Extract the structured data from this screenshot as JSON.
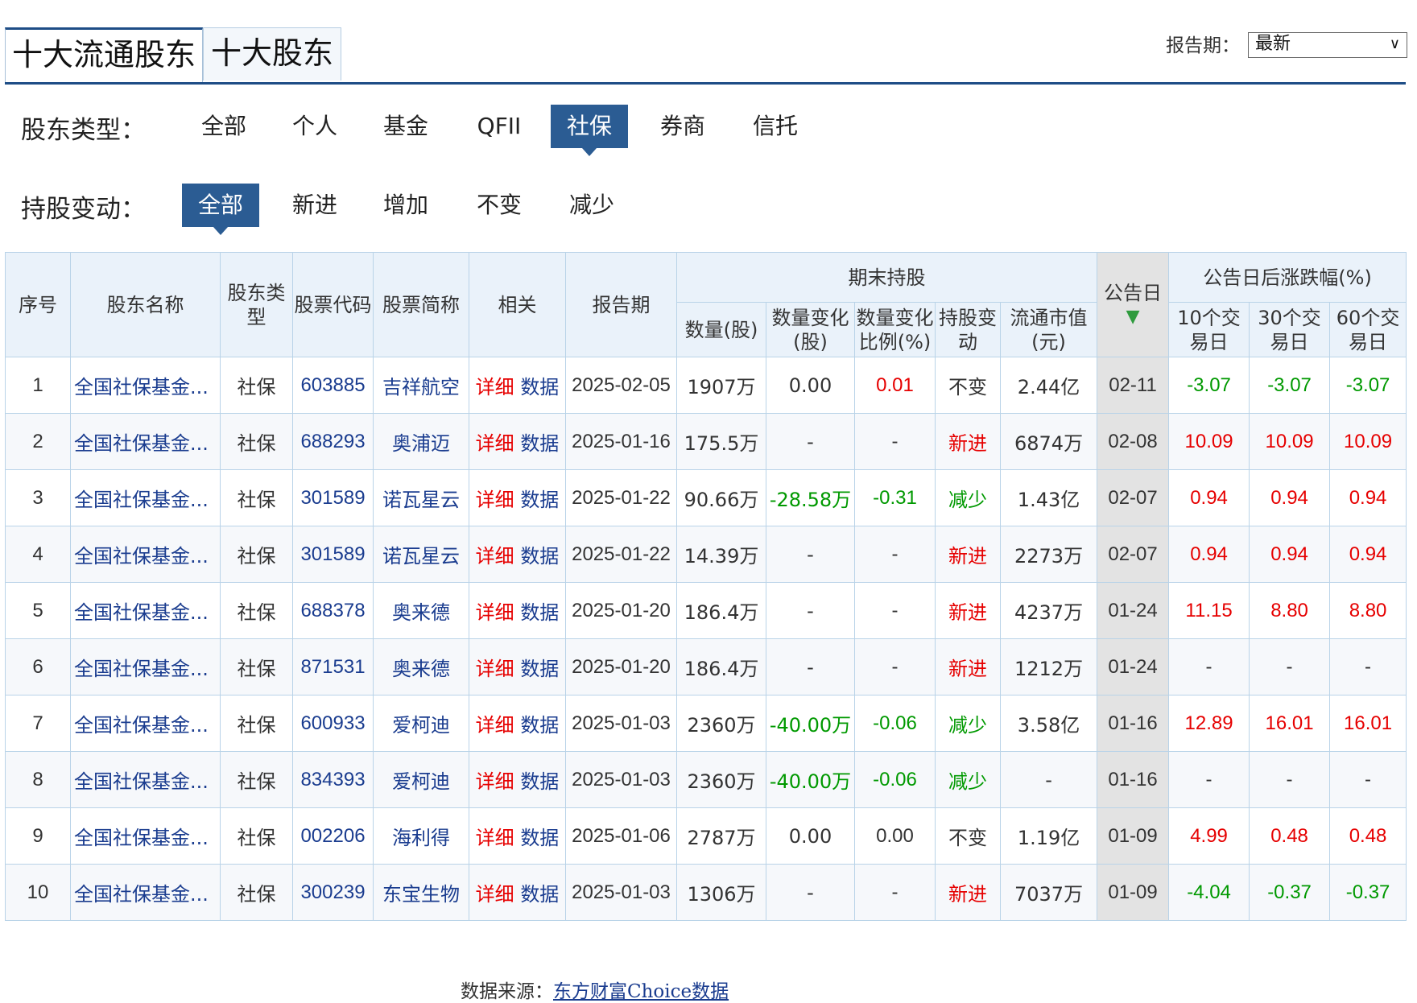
{
  "tabs": [
    "十大流通股东",
    "十大股东"
  ],
  "period": {
    "label": "报告期：",
    "selected": "最新"
  },
  "filters": {
    "holder_type": {
      "title": "股东类型：",
      "options": [
        "全部",
        "个人",
        "基金",
        "QFII",
        "社保",
        "券商",
        "信托"
      ],
      "active": 4
    },
    "change": {
      "title": "持股变动：",
      "options": [
        "全部",
        "新进",
        "增加",
        "不变",
        "减少"
      ],
      "active": 0
    }
  },
  "table": {
    "headers": {
      "index": "序号",
      "name": "股东名称",
      "type": "股东类型",
      "code": "股票代码",
      "short": "股票简称",
      "related": "相关",
      "period": "报告期",
      "group_holding": "期末持股",
      "qty": "数量(股)",
      "qty_change": "数量变化(股)",
      "ratio_change": "数量变化比例(%)",
      "hold_change": "持股变动",
      "market_value": "流通市值(元)",
      "announce": "公告日",
      "group_after": "公告日后涨跌幅(%)",
      "d10": "10个交易日",
      "d30": "30个交易日",
      "d60": "60个交易日"
    },
    "link_detail": "详细",
    "link_data": "数据",
    "rows": [
      {
        "idx": "1",
        "name": "全国社保基金...",
        "type": "社保",
        "code": "603885",
        "short": "吉祥航空",
        "date": "2025-02-05",
        "qty": "1907万",
        "qchg": "0.00",
        "rchg": "0.01",
        "rchg_c": "red",
        "hchg": "不变",
        "hchg_c": "",
        "mv": "2.44亿",
        "ann": "02-11",
        "d10": "-3.07",
        "d30": "-3.07",
        "d60": "-3.07",
        "c10": "green",
        "c30": "green",
        "c60": "green",
        "qchg_c": ""
      },
      {
        "idx": "2",
        "name": "全国社保基金...",
        "type": "社保",
        "code": "688293",
        "short": "奥浦迈",
        "date": "2025-01-16",
        "qty": "175.5万",
        "qchg": "-",
        "rchg": "-",
        "rchg_c": "",
        "hchg": "新进",
        "hchg_c": "red",
        "mv": "6874万",
        "ann": "02-08",
        "d10": "10.09",
        "d30": "10.09",
        "d60": "10.09",
        "c10": "red",
        "c30": "red",
        "c60": "red",
        "qchg_c": ""
      },
      {
        "idx": "3",
        "name": "全国社保基金...",
        "type": "社保",
        "code": "301589",
        "short": "诺瓦星云",
        "date": "2025-01-22",
        "qty": "90.66万",
        "qchg": "-28.58万",
        "rchg": "-0.31",
        "rchg_c": "green",
        "hchg": "减少",
        "hchg_c": "green",
        "mv": "1.43亿",
        "ann": "02-07",
        "d10": "0.94",
        "d30": "0.94",
        "d60": "0.94",
        "c10": "red",
        "c30": "red",
        "c60": "red",
        "qchg_c": "green"
      },
      {
        "idx": "4",
        "name": "全国社保基金...",
        "type": "社保",
        "code": "301589",
        "short": "诺瓦星云",
        "date": "2025-01-22",
        "qty": "14.39万",
        "qchg": "-",
        "rchg": "-",
        "rchg_c": "",
        "hchg": "新进",
        "hchg_c": "red",
        "mv": "2273万",
        "ann": "02-07",
        "d10": "0.94",
        "d30": "0.94",
        "d60": "0.94",
        "c10": "red",
        "c30": "red",
        "c60": "red",
        "qchg_c": ""
      },
      {
        "idx": "5",
        "name": "全国社保基金...",
        "type": "社保",
        "code": "688378",
        "short": "奥来德",
        "date": "2025-01-20",
        "qty": "186.4万",
        "qchg": "-",
        "rchg": "-",
        "rchg_c": "",
        "hchg": "新进",
        "hchg_c": "red",
        "mv": "4237万",
        "ann": "01-24",
        "d10": "11.15",
        "d30": "8.80",
        "d60": "8.80",
        "c10": "red",
        "c30": "red",
        "c60": "red",
        "qchg_c": ""
      },
      {
        "idx": "6",
        "name": "全国社保基金...",
        "type": "社保",
        "code": "871531",
        "short": "奥来德",
        "date": "2025-01-20",
        "qty": "186.4万",
        "qchg": "-",
        "rchg": "-",
        "rchg_c": "",
        "hchg": "新进",
        "hchg_c": "red",
        "mv": "1212万",
        "ann": "01-24",
        "d10": "-",
        "d30": "-",
        "d60": "-",
        "c10": "",
        "c30": "",
        "c60": "",
        "qchg_c": ""
      },
      {
        "idx": "7",
        "name": "全国社保基金...",
        "type": "社保",
        "code": "600933",
        "short": "爱柯迪",
        "date": "2025-01-03",
        "qty": "2360万",
        "qchg": "-40.00万",
        "rchg": "-0.06",
        "rchg_c": "green",
        "hchg": "减少",
        "hchg_c": "green",
        "mv": "3.58亿",
        "ann": "01-16",
        "d10": "12.89",
        "d30": "16.01",
        "d60": "16.01",
        "c10": "red",
        "c30": "red",
        "c60": "red",
        "qchg_c": "green"
      },
      {
        "idx": "8",
        "name": "全国社保基金...",
        "type": "社保",
        "code": "834393",
        "short": "爱柯迪",
        "date": "2025-01-03",
        "qty": "2360万",
        "qchg": "-40.00万",
        "rchg": "-0.06",
        "rchg_c": "green",
        "hchg": "减少",
        "hchg_c": "green",
        "mv": "-",
        "ann": "01-16",
        "d10": "-",
        "d30": "-",
        "d60": "-",
        "c10": "",
        "c30": "",
        "c60": "",
        "qchg_c": "green"
      },
      {
        "idx": "9",
        "name": "全国社保基金...",
        "type": "社保",
        "code": "002206",
        "short": "海利得",
        "date": "2025-01-06",
        "qty": "2787万",
        "qchg": "0.00",
        "rchg": "0.00",
        "rchg_c": "",
        "hchg": "不变",
        "hchg_c": "",
        "mv": "1.19亿",
        "ann": "01-09",
        "d10": "4.99",
        "d30": "0.48",
        "d60": "0.48",
        "c10": "red",
        "c30": "red",
        "c60": "red",
        "qchg_c": ""
      },
      {
        "idx": "10",
        "name": "全国社保基金...",
        "type": "社保",
        "code": "300239",
        "short": "东宝生物",
        "date": "2025-01-03",
        "qty": "1306万",
        "qchg": "-",
        "rchg": "-",
        "rchg_c": "",
        "hchg": "新进",
        "hchg_c": "red",
        "mv": "7037万",
        "ann": "01-09",
        "d10": "-4.04",
        "d30": "-0.37",
        "d60": "-0.37",
        "c10": "green",
        "c30": "green",
        "c60": "green",
        "qchg_c": ""
      }
    ]
  },
  "source": {
    "label": "数据来源：",
    "link": "东方财富Choice数据"
  },
  "colors": {
    "accent": "#2b5c93",
    "up": "#e60000",
    "down": "#009900",
    "link": "#1a3c8f"
  }
}
